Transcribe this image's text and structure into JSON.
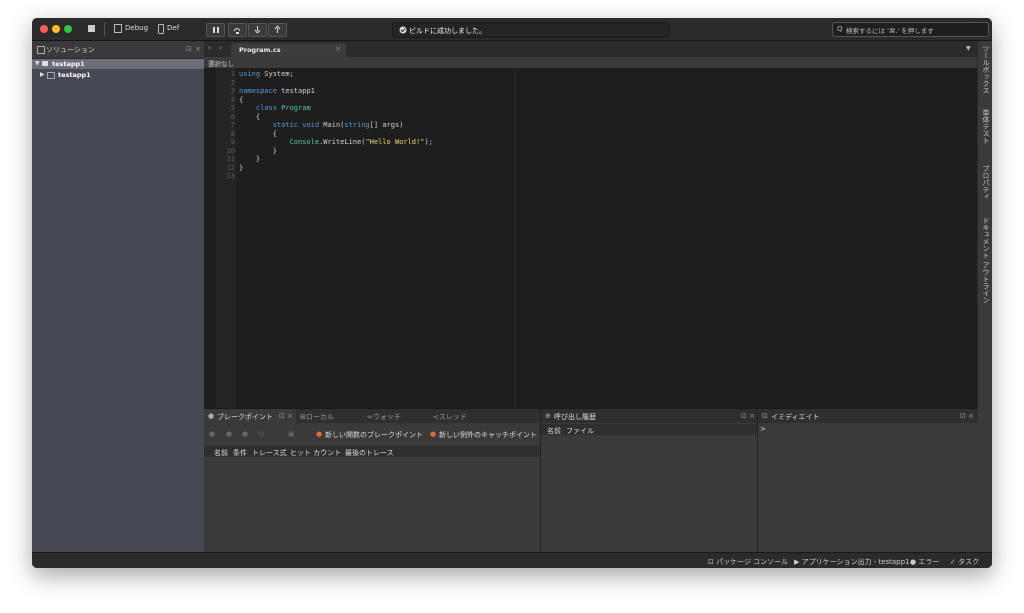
{
  "toolbar": {
    "config": "Debug",
    "platform": "Def",
    "build_status": "ビルドに成功しました。",
    "search_placeholder": "検索するには '⌘.' を押します"
  },
  "solution": {
    "title": "ソリューション",
    "root": "testapp1",
    "project": "testapp1"
  },
  "editor": {
    "tab": "Program.cs",
    "crumb": "選択なし",
    "line_numbers": "1\n2\n3\n4\n5\n6\n7\n8\n9\n10\n11\n12\n13",
    "code": [
      {
        "parts": [
          [
            "k",
            "using"
          ],
          [
            "",
            " System;"
          ]
        ]
      },
      {
        "parts": []
      },
      {
        "parts": [
          [
            "k",
            "namespace"
          ],
          [
            "",
            " testapp1"
          ]
        ]
      },
      {
        "parts": [
          [
            "",
            "{"
          ]
        ]
      },
      {
        "parts": [
          [
            "",
            "    "
          ],
          [
            "k",
            "class"
          ],
          [
            "",
            " "
          ],
          [
            "t",
            "Program"
          ]
        ]
      },
      {
        "parts": [
          [
            "",
            "    {"
          ]
        ]
      },
      {
        "parts": [
          [
            "",
            "        "
          ],
          [
            "k",
            "static"
          ],
          [
            "",
            " "
          ],
          [
            "k",
            "void"
          ],
          [
            "",
            " Main("
          ],
          [
            "k",
            "string"
          ],
          [
            "",
            "[] args)"
          ]
        ]
      },
      {
        "parts": [
          [
            "",
            "        {"
          ]
        ]
      },
      {
        "parts": [
          [
            "",
            "            "
          ],
          [
            "t",
            "Console"
          ],
          [
            "",
            ".WriteLine("
          ],
          [
            "s",
            "\"Hello World!\""
          ],
          [
            "",
            ");"
          ]
        ]
      },
      {
        "parts": [
          [
            "",
            "        }"
          ]
        ]
      },
      {
        "parts": [
          [
            "",
            "    }"
          ]
        ]
      },
      {
        "parts": [
          [
            "",
            "}"
          ]
        ]
      },
      {
        "parts": []
      }
    ]
  },
  "right_pads": [
    "ツールボックス",
    "単体テスト",
    "プロパティ",
    "ドキュメント アウトライン"
  ],
  "breakpoints": {
    "tabs": [
      "ブレークポイント",
      "ローカル",
      "ウォッチ",
      "スレッド"
    ],
    "new_function_bp": "新しい関数のブレークポイント",
    "new_exception_bp": "新しい例外のキャッチポイント",
    "columns": [
      "名前",
      "条件",
      "トレース式",
      "ヒット カウント",
      "最後のトレース"
    ]
  },
  "callstack": {
    "title": "呼び出し履歴",
    "columns": [
      "名前",
      "ファイル"
    ]
  },
  "immediate": {
    "title": "イミディエイト",
    "prompt": ">"
  },
  "status_bar": {
    "package_console": "パッケージ コンソール",
    "app_output": "アプリケーション出力 - testapp1",
    "errors": "エラー",
    "tasks": "タスク"
  },
  "colors": {
    "close": "#ff5f57",
    "minimize": "#febc2e",
    "zoom": "#28c840"
  }
}
